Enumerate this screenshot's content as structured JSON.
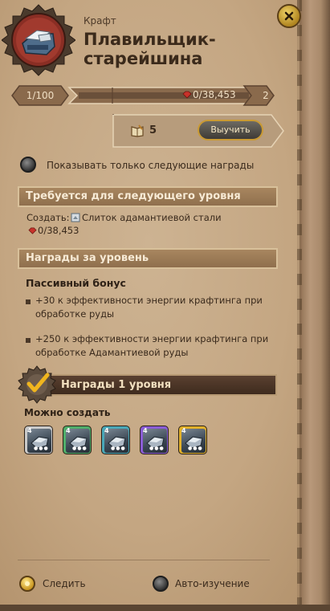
{
  "header": {
    "category": "Крафт",
    "title": "Плавильщик-старейшина"
  },
  "progress": {
    "current_level": "1/100",
    "fame_text": "0/38,453",
    "next_level": "2",
    "fill_fraction": 0.0
  },
  "study": {
    "book_count": "5",
    "button_label": "Выучить"
  },
  "filters": {
    "show_next_only_label": "Показывать только следующие награды"
  },
  "requirements": {
    "header": "Требуется для следующего уровня",
    "create_prefix": "Создать:",
    "item_name": "Слиток адамантиевой стали",
    "amount": "0/38,453"
  },
  "rewards": {
    "header": "Награды за уровень",
    "passive_title": "Пассивный бонус",
    "bonuses": [
      "+30 к эффективности энергии крафтинга при обработке руды",
      "+250 к эффективности энергии крафтинга при обработке Адамантиевой руды"
    ]
  },
  "tier_rewards": {
    "header": "Награды 1 уровня",
    "can_create": "Можно создать",
    "items": [
      {
        "name": "Слиток адамантиевой стали",
        "tier": "4",
        "rarity": "normal",
        "color": "#c9c9c9"
      },
      {
        "name": "Слиток адамантиевой стали",
        "tier": "4",
        "rarity": "good",
        "color": "#4fae6a"
      },
      {
        "name": "Слиток адамантиевой стали",
        "tier": "4",
        "rarity": "outstanding",
        "color": "#49a8b8"
      },
      {
        "name": "Слиток адамантиевой стали",
        "tier": "4",
        "rarity": "excellent",
        "color": "#8a5cd6"
      },
      {
        "name": "Слиток адамантиевой стали",
        "tier": "4",
        "rarity": "masterpiece",
        "color": "#e1b02a"
      }
    ]
  },
  "footer": {
    "follow_label": "Следить",
    "auto_study_label": "Авто-изучение"
  },
  "colors": {
    "parchment": "#c4a682",
    "header_brown": "#8f6f4d",
    "gold": "#c99a34",
    "text_dark": "#3a2a1c"
  }
}
